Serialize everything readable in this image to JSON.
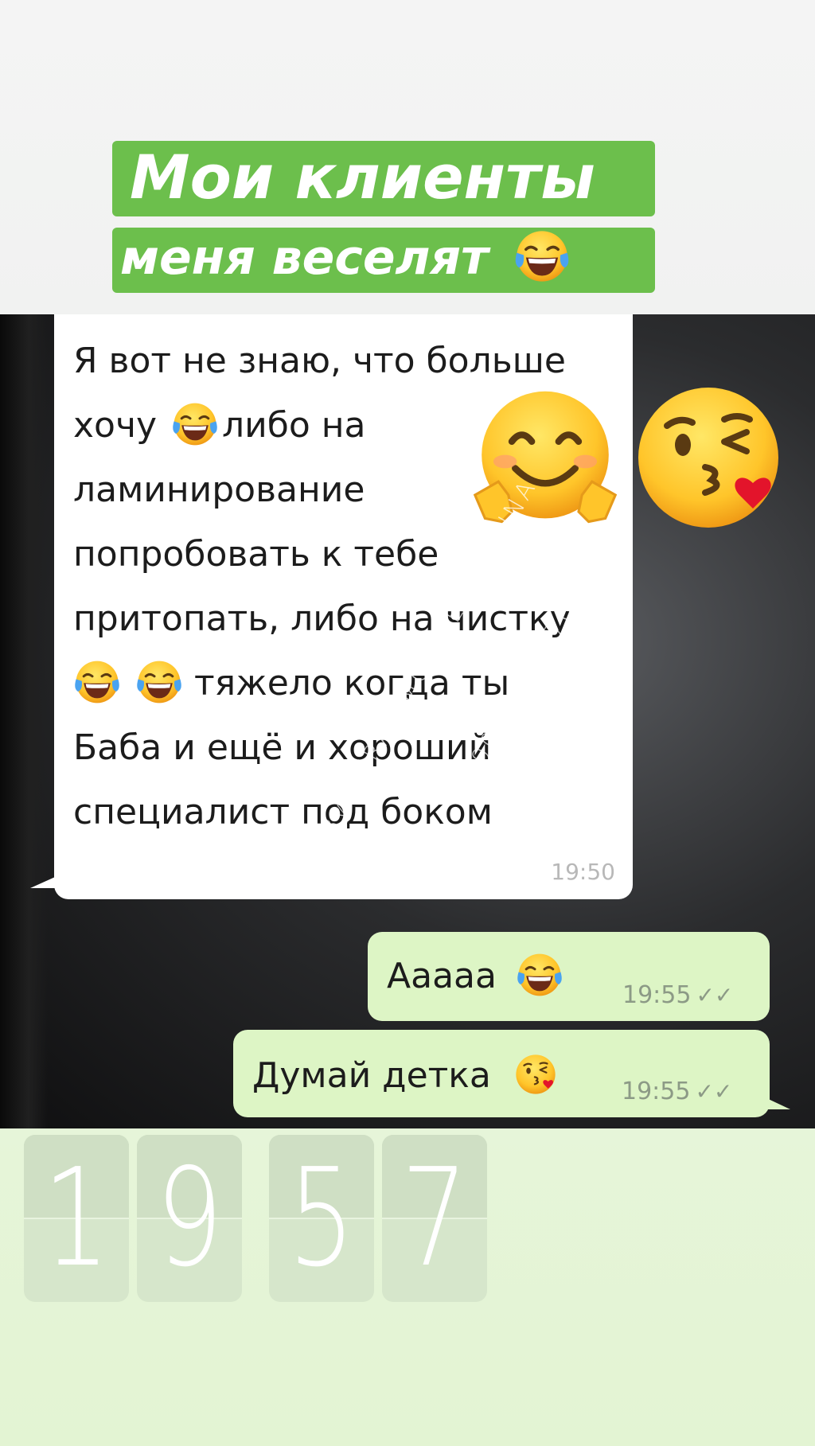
{
  "title": {
    "line1": "Мои клиенты",
    "line2": "меня веселят"
  },
  "incoming_message": {
    "lines": [
      "Я вот не знаю, что больше",
      "хочу",
      "либо на",
      "ламинирование",
      "попробовать  к тебе",
      "притопать, либо на чистку",
      "тяжело когда ты",
      "Баба и ещё и хороший",
      "специалист под боком"
    ],
    "time": "19:50"
  },
  "outgoing_messages": [
    {
      "text": "Ааааа",
      "time": "19:55"
    },
    {
      "text": "Думай детка",
      "time": "19:55"
    }
  ],
  "watermark": {
    "line1": "By GERASIMOVA EKATERINA",
    "line2": "89098041770"
  },
  "clock": {
    "digits": [
      "1",
      "9",
      "5",
      "7"
    ]
  },
  "icons": {
    "laughing": "face-with-tears-of-joy-icon",
    "hugging": "hugging-face-icon",
    "kiss": "face-blowing-kiss-icon",
    "read_ticks": "double-check-icon"
  },
  "colors": {
    "title_bg": "#6cbf4c",
    "bubble_out": "#ddf5c5",
    "bottom_bg": "#e4f4d6"
  }
}
